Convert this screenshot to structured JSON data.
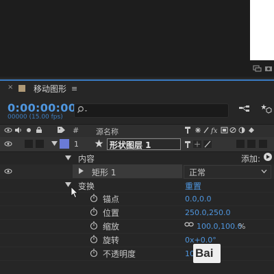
{
  "panel": {
    "tab_close": "×",
    "tab_title": "移动图形",
    "tab_menu": "≡"
  },
  "time": {
    "timecode": "0:00:00:00",
    "frames": "00000 (15.00 fps)"
  },
  "search": {
    "placeholder": ""
  },
  "columns": {
    "hash": "#",
    "source_name": "源名称"
  },
  "layer": {
    "number": "1",
    "name": "形状图层 1"
  },
  "contents": {
    "label": "内容",
    "add_label": "添加:"
  },
  "rectangle": {
    "label": "矩形 1",
    "blend_mode": "正常"
  },
  "transform": {
    "label": "变换",
    "reset": "重置"
  },
  "properties": [
    {
      "name": "锚点",
      "value": "0.0,0.0"
    },
    {
      "name": "位置",
      "value": "250.0,250.0"
    },
    {
      "name": "缩放",
      "value": "100.0,100.0",
      "unit": "%"
    },
    {
      "name": "旋转",
      "value": "0x+0.0°"
    },
    {
      "name": "不透明度",
      "value": "10"
    }
  ],
  "watermark": {
    "text": "Bai"
  },
  "colors": {
    "accent": "#4f97e0",
    "label_color": "#6a7bd6",
    "panel_bg": "#262626"
  }
}
